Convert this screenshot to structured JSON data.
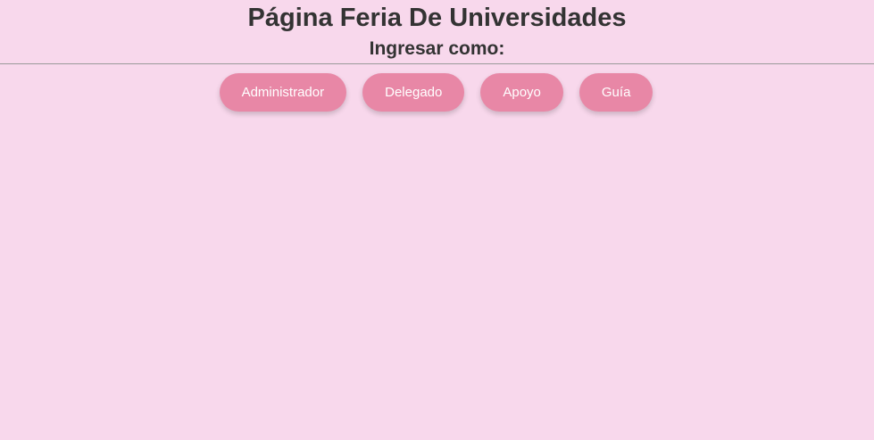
{
  "header": {
    "title": "Página Feria De Universidades",
    "subtitle": "Ingresar como:"
  },
  "roles": {
    "admin_label": "Administrador",
    "delegate_label": "Delegado",
    "support_label": "Apoyo",
    "guide_label": "Guía"
  },
  "colors": {
    "background": "#f8d8ec",
    "button": "#e887a6",
    "text": "#333333"
  }
}
